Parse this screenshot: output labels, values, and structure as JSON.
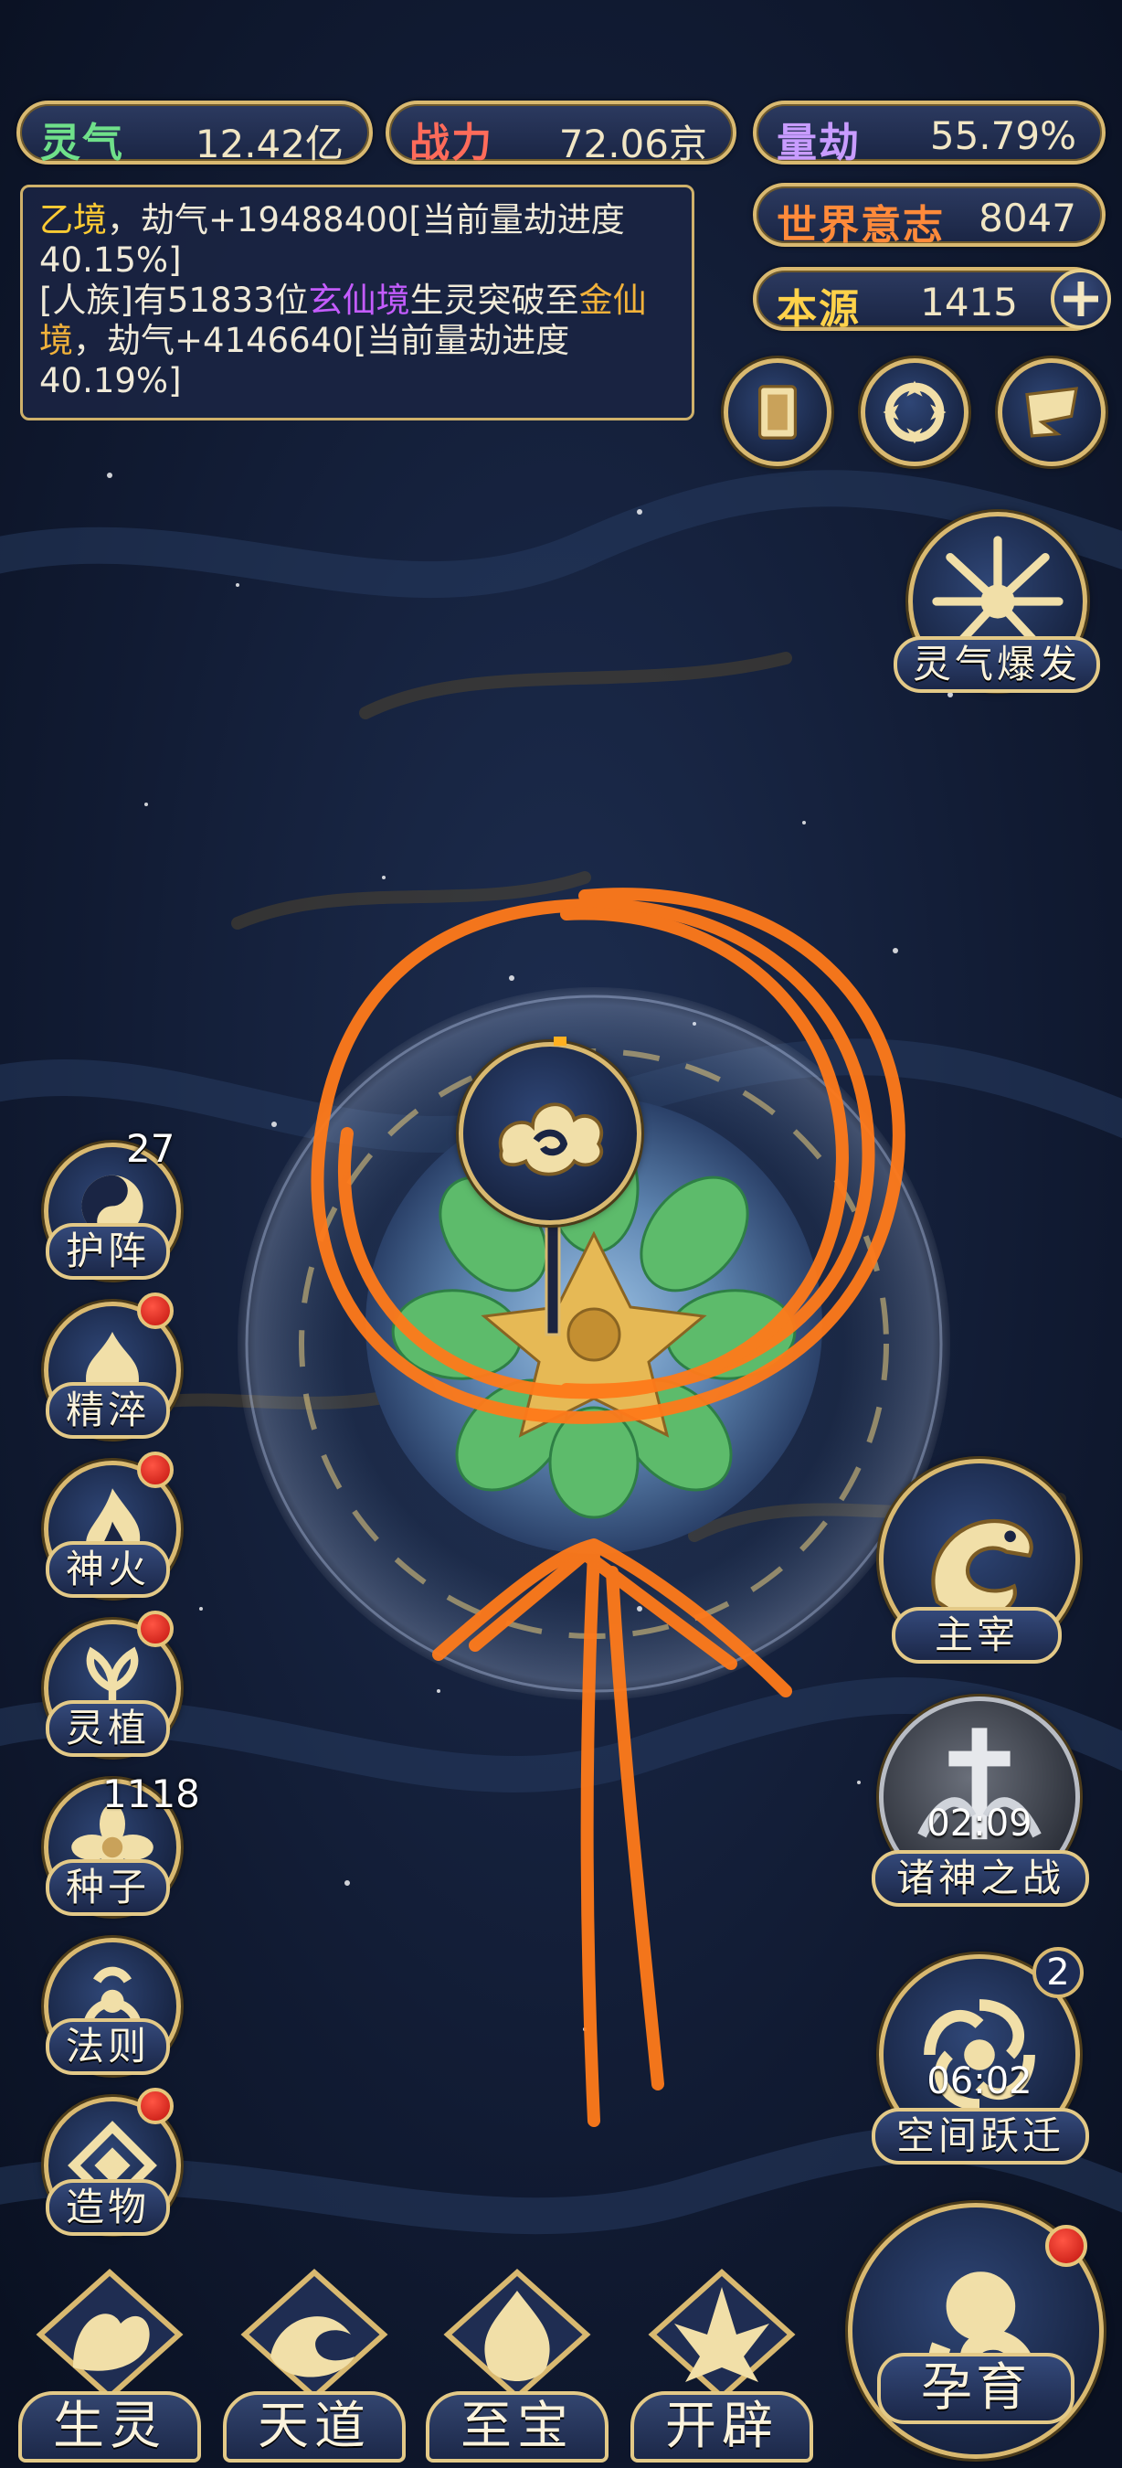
{
  "top_bar": {
    "lingqi": {
      "label": "灵气",
      "value": "12.42亿",
      "label_color": "#6fe08a"
    },
    "zhanli": {
      "label": "战力",
      "value": "72.06京",
      "label_color": "#ff6b5a"
    },
    "liangjie": {
      "label": "量劫",
      "value": "55.79%",
      "label_color": "#c89cff"
    },
    "world_will": {
      "label": "世界意志",
      "value": "8047",
      "label_color": "#ff8a3a"
    },
    "benyuan": {
      "label": "本源",
      "value": "1415",
      "label_color": "#ffd24a"
    }
  },
  "message_log": {
    "line1_a": "乙境",
    "line1_b": "，劫气+19488400[当前量劫进度40.15%]",
    "line2_a": "[人族]有51833位",
    "line2_b": "玄仙境",
    "line2_c": "生灵突破至",
    "line2_d": "金仙境",
    "line2_e": "，劫气+4146640[当前量劫进度40.19%]"
  },
  "right_icons": {
    "burst_label": "灵气爆发"
  },
  "left_menu": [
    {
      "label": "护阵",
      "badge": "27"
    },
    {
      "label": "精淬"
    },
    {
      "label": "神火"
    },
    {
      "label": "灵植"
    },
    {
      "label": "种子",
      "badge": "1118"
    },
    {
      "label": "法则"
    },
    {
      "label": "造物"
    }
  ],
  "right_menu": {
    "master": {
      "label": "主宰"
    },
    "gods_war": {
      "label": "诸神之战",
      "timer": "02:09"
    },
    "space_jump": {
      "label": "空间跃迁",
      "timer": "06:02",
      "badge": "2"
    },
    "nurture": {
      "label": "孕育"
    }
  },
  "bottom_nav": [
    "生灵",
    "天道",
    "至宝",
    "开辟"
  ],
  "colors": {
    "accent_gold": "#d9b970",
    "annotation_orange": "#ff7a1a",
    "background": "#0c1426"
  }
}
